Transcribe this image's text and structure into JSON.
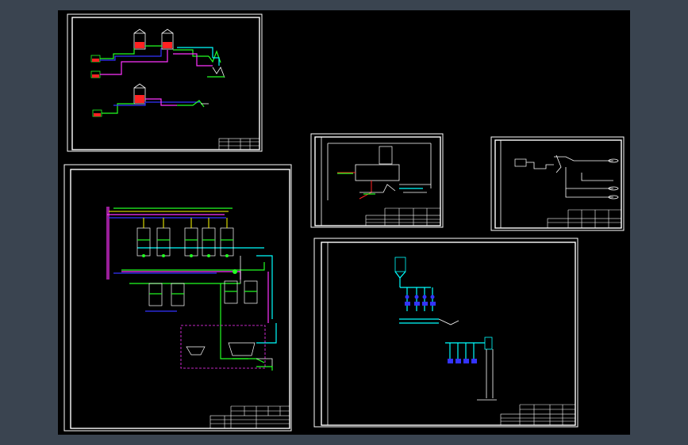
{
  "viewport": {
    "background": "#3a4450",
    "canvas": "#000000"
  },
  "colors": {
    "frame": "#ffffff",
    "pipe_green": "#22ff22",
    "pipe_blue": "#3333ff",
    "pipe_magenta": "#ff33ff",
    "pipe_cyan": "#00ffff",
    "pipe_red": "#ff2222",
    "pipe_yellow": "#ffff00"
  },
  "sheets": [
    {
      "id": "sheet-1",
      "content": "process-flow-tanks"
    },
    {
      "id": "sheet-2",
      "content": "multi-reactor-piping"
    },
    {
      "id": "sheet-3",
      "content": "tower-piping"
    },
    {
      "id": "sheet-4",
      "content": "branch-piping"
    },
    {
      "id": "sheet-5",
      "content": "distribution-manifold"
    }
  ]
}
